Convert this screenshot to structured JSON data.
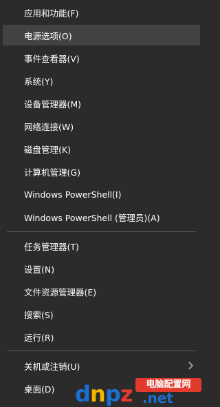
{
  "menu": {
    "items": [
      {
        "label": "应用和功能(F)"
      },
      {
        "label": "电源选项(O)"
      },
      {
        "label": "事件查看器(V)"
      },
      {
        "label": "系统(Y)"
      },
      {
        "label": "设备管理器(M)"
      },
      {
        "label": "网络连接(W)"
      },
      {
        "label": "磁盘管理(K)"
      },
      {
        "label": "计算机管理(G)"
      },
      {
        "label": "Windows PowerShell(I)"
      },
      {
        "label": "Windows PowerShell (管理员)(A)"
      },
      {
        "label": "任务管理器(T)"
      },
      {
        "label": "设置(N)"
      },
      {
        "label": "文件资源管理器(E)"
      },
      {
        "label": "搜索(S)"
      },
      {
        "label": "运行(R)"
      },
      {
        "label": "关机或注销(U)"
      },
      {
        "label": "桌面(D)"
      }
    ],
    "highlighted_index": 1
  },
  "watermark": {
    "logo_text": "dnpz",
    "badge_text": "电脑配置网",
    "domain_text": ".net"
  },
  "colors": {
    "background": "#2b2b2b",
    "highlight": "#424242",
    "separator": "#5a5a5a",
    "text": "#ffffff",
    "watermark_red": "#e23a2c",
    "watermark_blue": "#1a6fd0",
    "watermark_yellow": "#f5b400"
  },
  "icons": {
    "submenu": "chevron-right-icon"
  }
}
